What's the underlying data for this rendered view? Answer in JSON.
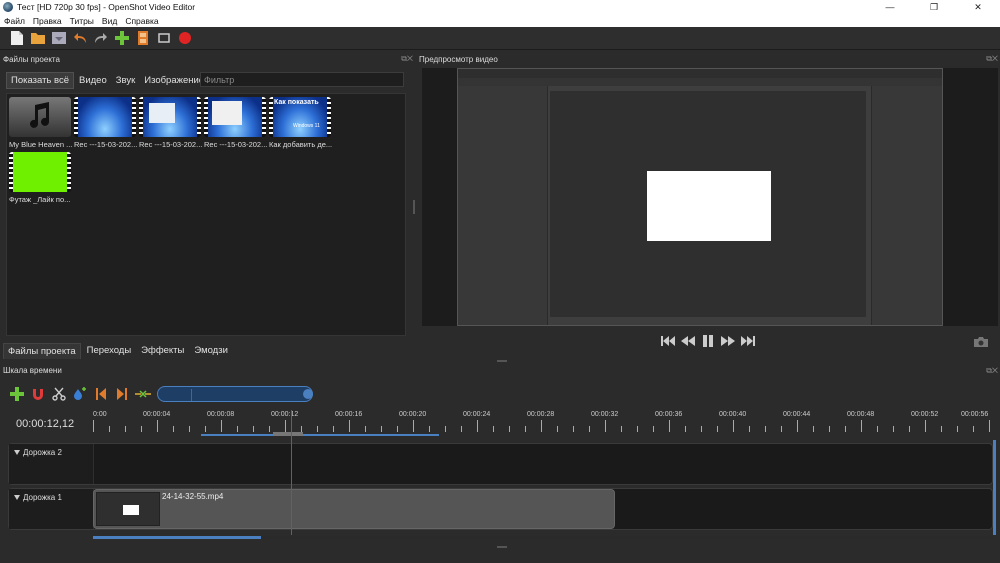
{
  "window": {
    "title": "Тест [HD 720p 30 fps] - OpenShot Video Editor",
    "min": "—",
    "max": "❐",
    "close": "✕"
  },
  "menu": [
    "Файл",
    "Правка",
    "Титры",
    "Вид",
    "Справка"
  ],
  "panels": {
    "files_title": "Файлы проекта",
    "preview_title": "Предпросмотр видео",
    "timeline_title": "Шкала времени"
  },
  "filters": {
    "tabs": [
      "Показать всё",
      "Видео",
      "Звук",
      "Изображение"
    ],
    "placeholder": "Фильтр"
  },
  "files": [
    {
      "label": "My Blue Heaven ...",
      "kind": "audio"
    },
    {
      "label": "Rec ---15-03-202...",
      "kind": "video-win"
    },
    {
      "label": "Rec ---15-03-202...",
      "kind": "video-win"
    },
    {
      "label": "Rec ---15-03-202...",
      "kind": "video-win"
    },
    {
      "label": "Как добавить де...",
      "kind": "video-howto"
    },
    {
      "label": "Футаж _Лайк по...",
      "kind": "video-green"
    }
  ],
  "thumb_texts": {
    "howto_title": "Как показать",
    "howto_sub": "Windows 11"
  },
  "bottom_tabs": [
    "Файлы проекта",
    "Переходы",
    "Эффекты",
    "Эмодзи"
  ],
  "timeline": {
    "timecode": "00:00:12,12",
    "ticks": [
      "0:00",
      "00:00:04",
      "00:00:08",
      "00:00:12",
      "00:00:16",
      "00:00:20",
      "00:00:24",
      "00:00:28",
      "00:00:32",
      "00:00:36",
      "00:00:40",
      "00:00:44",
      "00:00:48",
      "00:00:52",
      "00:00:56"
    ],
    "tracks": [
      {
        "name": "Дорожка 2"
      },
      {
        "name": "Дорожка 1"
      }
    ],
    "clip_name": "24-14-32-55.mp4"
  },
  "colors": {
    "accent_blue": "#4a7fc0",
    "playhead": "#cc3333",
    "green_screen": "#6ef000"
  }
}
